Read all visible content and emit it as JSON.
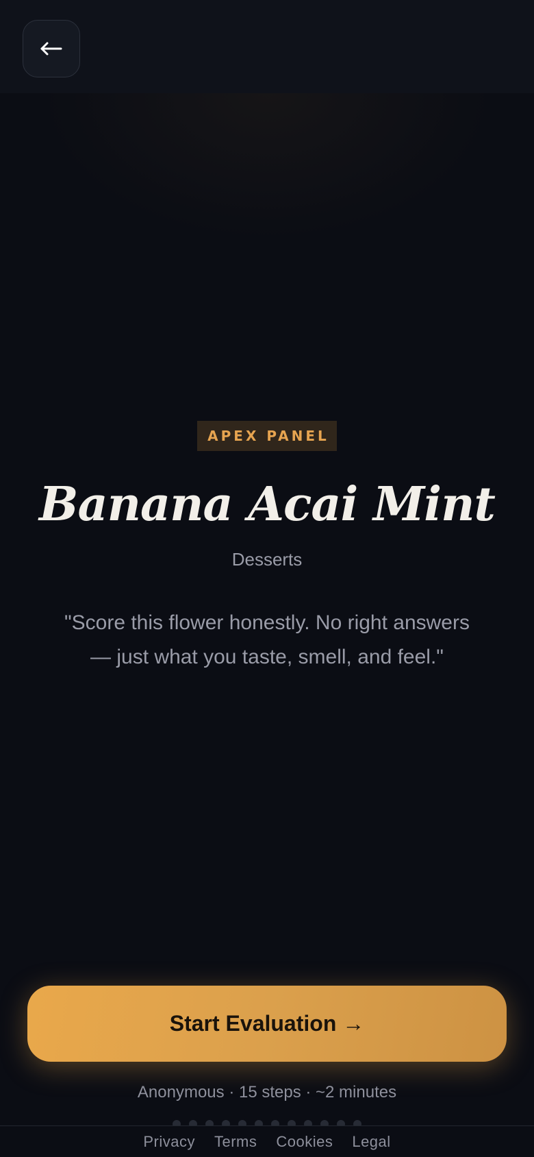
{
  "header": {
    "back_label": "←"
  },
  "panel_badge": "APEX PANEL",
  "product": {
    "name": "Banana Acai Mint",
    "category": "Desserts"
  },
  "intro_quote": "\"Score this flower honestly. No right answers — just what you taste, smell, and feel.\"",
  "cta": {
    "label": "Start Evaluation →"
  },
  "meta_info": "Anonymous · 15 steps · ~2 minutes",
  "progress": {
    "total_steps": 15,
    "visible_dots": 12
  },
  "footer": {
    "links": [
      "Privacy",
      "Terms",
      "Cookies",
      "Legal"
    ]
  },
  "colors": {
    "background": "#0b0d14",
    "accent": "#e6a450",
    "cta_gradient_start": "#e9a84b",
    "cta_gradient_end": "#cd9243",
    "title": "#f2efe9",
    "muted_text": "#9a9ca8"
  },
  "icons": {
    "back": "arrow-left-icon"
  }
}
